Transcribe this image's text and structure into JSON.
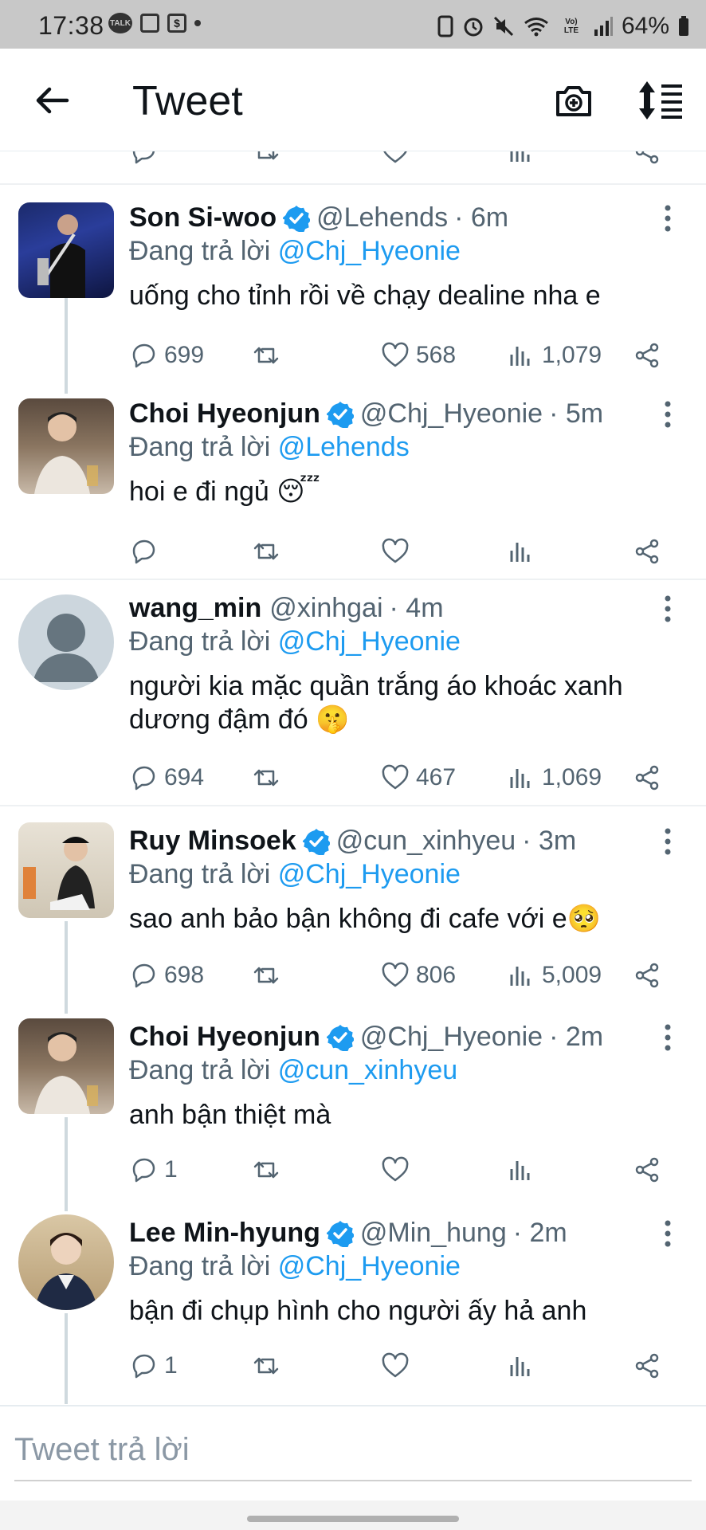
{
  "status_bar": {
    "time": "17:38",
    "talk_badge": "TALK",
    "volte": "Vo) LTE",
    "battery": "64%"
  },
  "header": {
    "title": "Tweet"
  },
  "tweets": [
    {
      "name": "Son Si-woo",
      "verified": true,
      "handle": "@Lehends",
      "time": "· 6m",
      "reply_prefix": "Đang trả lời",
      "reply_to": "@Chj_Hyeonie",
      "text": "uống cho tỉnh rồi về chạy dealine nha e",
      "replies": "699",
      "retweets": "",
      "likes": "568",
      "views": "1,079"
    },
    {
      "name": "Choi Hyeonjun",
      "verified": true,
      "handle": "@Chj_Hyeonie",
      "time": "· 5m",
      "reply_prefix": "Đang trả lời",
      "reply_to": "@Lehends",
      "text": "hoi e đi ngủ 😴",
      "replies": "",
      "retweets": "",
      "likes": "",
      "views": ""
    },
    {
      "name": "wang_min",
      "verified": false,
      "handle": "@xinhgai",
      "time": "· 4m",
      "reply_prefix": "Đang trả lời",
      "reply_to": "@Chj_Hyeonie",
      "text": "người kia mặc quần trắng áo khoác xanh dương đậm đó 🤫",
      "replies": "694",
      "retweets": "",
      "likes": "467",
      "views": "1,069"
    },
    {
      "name": "Ruy Minsoek",
      "verified": true,
      "handle": "@cun_xinhyeu",
      "time": "· 3m",
      "reply_prefix": "Đang trả lời",
      "reply_to": "@Chj_Hyeonie",
      "text": "sao anh bảo bận không đi cafe với e🥺",
      "replies": "698",
      "retweets": "",
      "likes": "806",
      "views": "5,009"
    },
    {
      "name": "Choi Hyeonjun",
      "verified": true,
      "handle": "@Chj_Hyeonie",
      "time": "· 2m",
      "reply_prefix": "Đang trả lời",
      "reply_to": "@cun_xinhyeu",
      "text": "anh bận thiệt mà",
      "replies": "1",
      "retweets": "",
      "likes": "",
      "views": ""
    },
    {
      "name": "Lee Min-hyung",
      "verified": true,
      "handle": "@Min_hung",
      "time": "· 2m",
      "reply_prefix": "Đang trả lời",
      "reply_to": "@Chj_Hyeonie",
      "text": "bận đi chụp hình cho người ấy hả anh",
      "replies": "1",
      "retweets": "",
      "likes": "",
      "views": ""
    }
  ],
  "composer": {
    "placeholder": "Tweet trả lời"
  },
  "colors": {
    "accent": "#1d9bf0",
    "secondary_text": "#536471",
    "divider": "#eef1f3",
    "status_bar_bg": "#c8c8c8"
  }
}
